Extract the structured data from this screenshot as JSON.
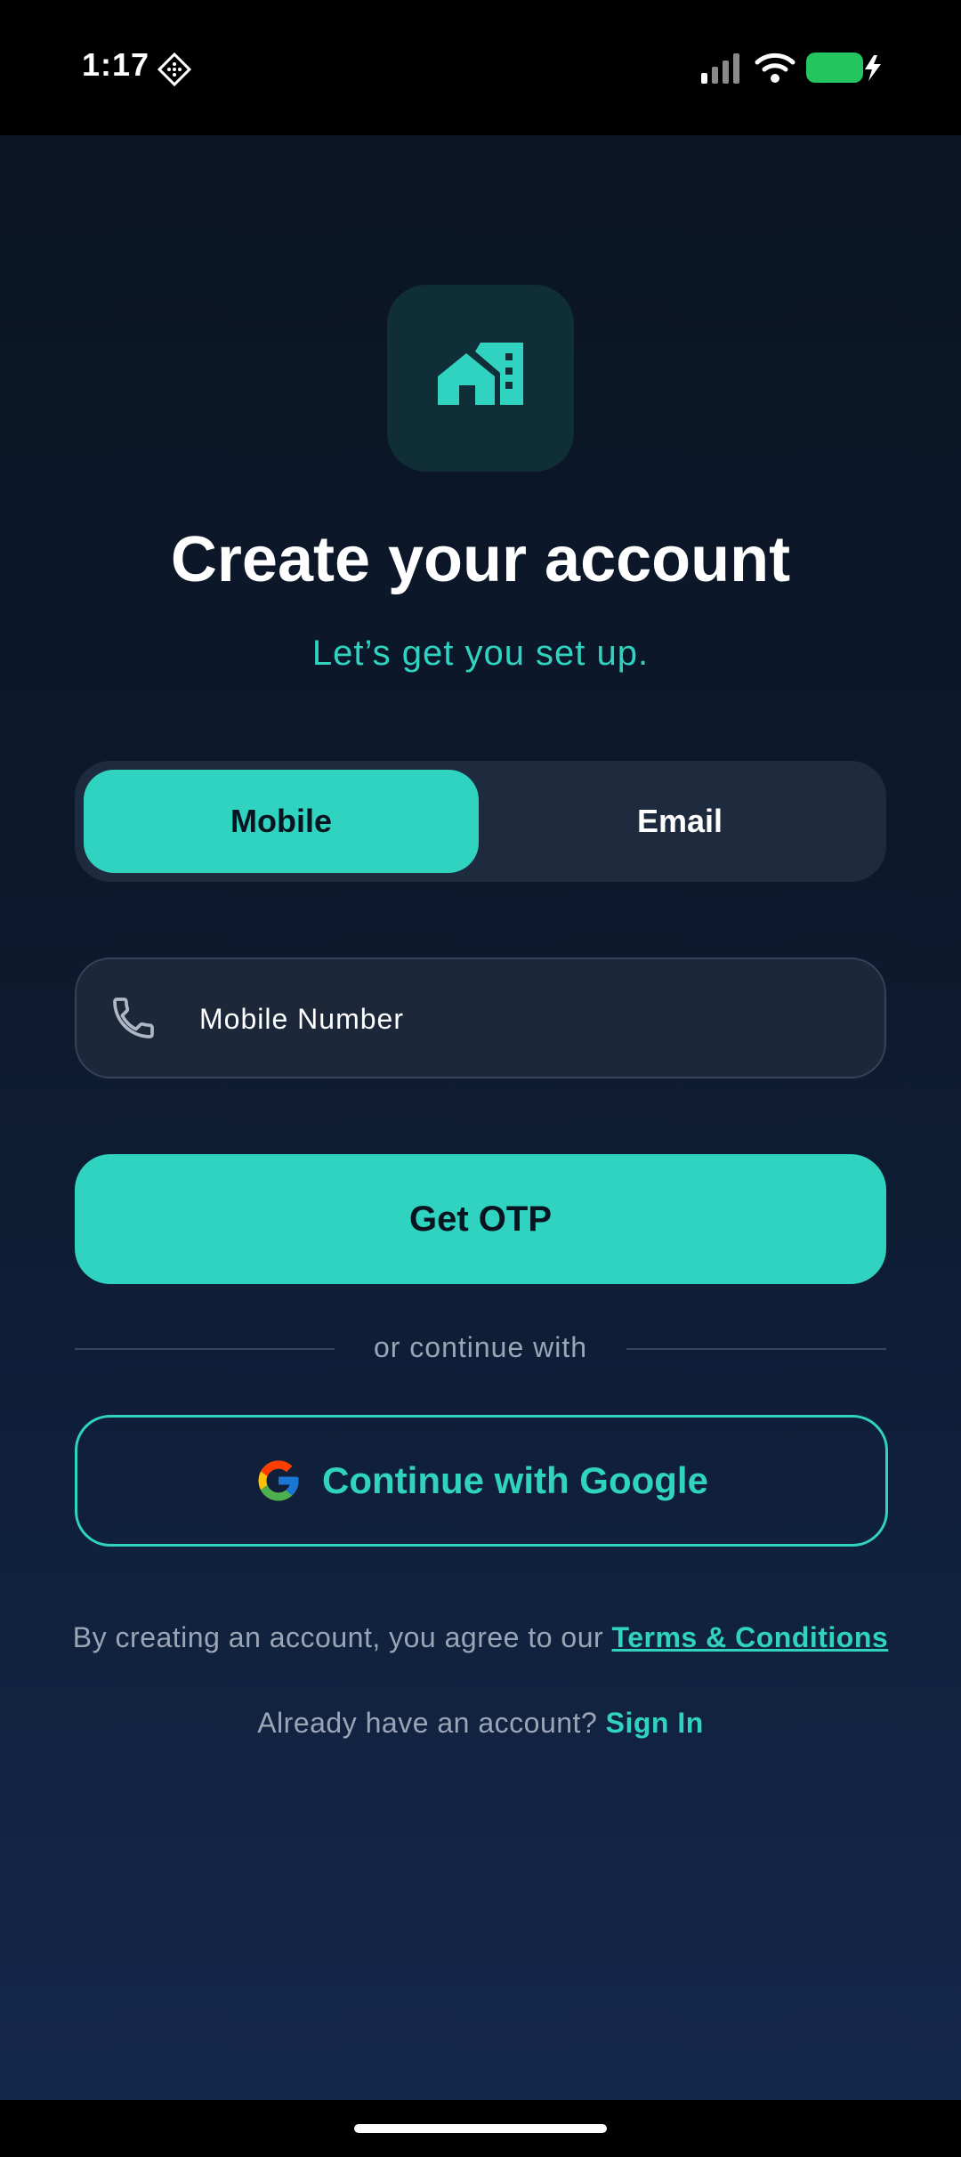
{
  "status_bar": {
    "time": "1:17",
    "icons": [
      "location-diamond-icon",
      "signal-icon",
      "wifi-icon",
      "battery-charging-icon"
    ],
    "battery_color": "#22c55e"
  },
  "app": {
    "logo_icon": "house-building-icon",
    "title": "Create your account",
    "subtitle": "Let’s get you set up."
  },
  "tabs": {
    "mobile_label": "Mobile",
    "email_label": "Email",
    "selected": "Mobile"
  },
  "form": {
    "phone_icon": "phone-icon",
    "mobile_placeholder": "Mobile Number",
    "mobile_value": "",
    "submit_label": "Get OTP"
  },
  "divider": {
    "text": "or continue with"
  },
  "social": {
    "google_icon": "google-g-icon",
    "google_label": "Continue with Google"
  },
  "footer": {
    "terms_prefix": "By creating an account, you agree to our ",
    "terms_link": "Terms & Conditions",
    "signin_prefix": "Already have an account? ",
    "signin_link": "Sign In"
  },
  "colors": {
    "accent": "#2fd3c0",
    "background_top": "#0a1423",
    "background_bottom": "#14284a",
    "surface": "#1e2a3d"
  }
}
